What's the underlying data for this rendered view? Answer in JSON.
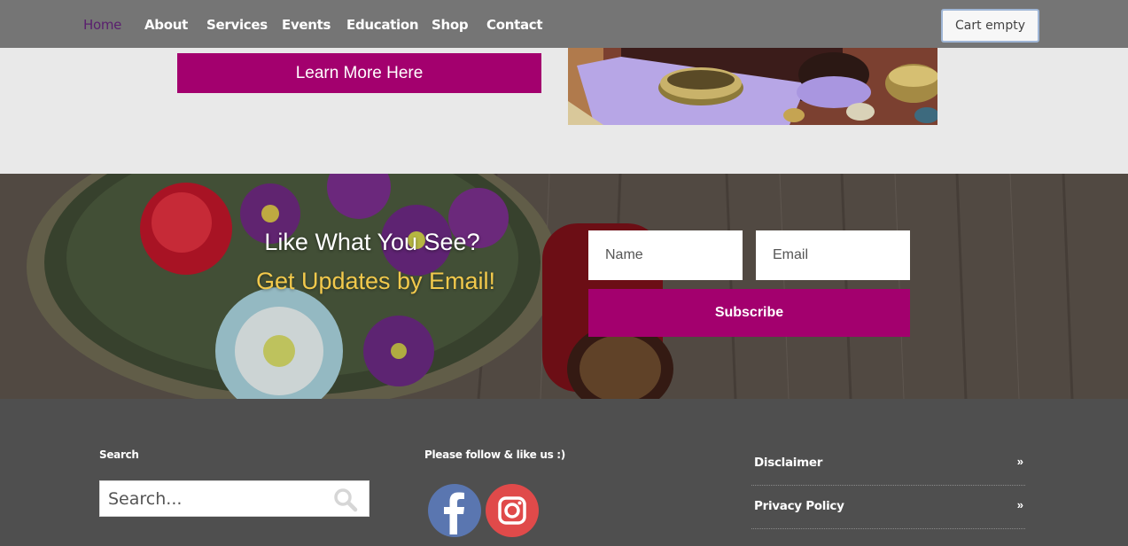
{
  "nav": {
    "items": [
      {
        "label": "Home",
        "active": true
      },
      {
        "label": "About"
      },
      {
        "label": "Services"
      },
      {
        "label": "Events"
      },
      {
        "label": "Education"
      },
      {
        "label": "Shop"
      },
      {
        "label": "Contact"
      }
    ],
    "cart_label": "Cart empty"
  },
  "hero": {
    "learn_more_label": "Learn More Here"
  },
  "subscribe": {
    "title": "Like What You See?",
    "subtitle": "Get Updates by Email!",
    "name_placeholder": "Name",
    "email_placeholder": "Email",
    "button_label": "Subscribe"
  },
  "footer": {
    "search_heading": "Search",
    "search_placeholder": "Search...",
    "social_heading": "Please follow & like us :)",
    "social_icons": [
      "facebook-icon",
      "instagram-icon"
    ],
    "links": [
      {
        "label": "Disclaimer",
        "arrow": "»"
      },
      {
        "label": "Privacy Policy",
        "arrow": "»"
      }
    ]
  },
  "colors": {
    "nav_bg": "#757575",
    "accent": "#a3006e",
    "highlight": "#f2c94c",
    "footer_bg": "#4f4f4f",
    "active_nav": "#5a1f6e"
  }
}
